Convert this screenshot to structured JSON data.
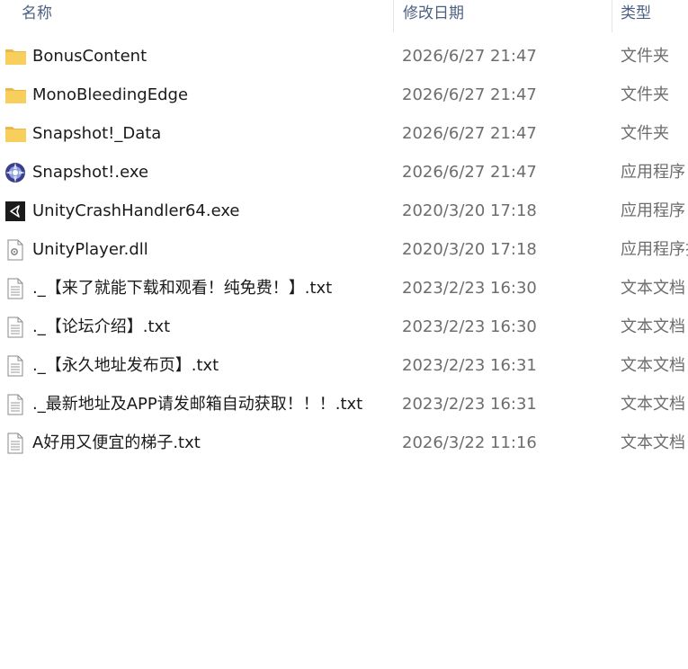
{
  "columns": {
    "name": "名称",
    "date": "修改日期",
    "type": "类型"
  },
  "files": [
    {
      "icon": "folder-icon",
      "name": "BonusContent",
      "date": "2026/6/27 21:47",
      "type": "文件夹"
    },
    {
      "icon": "folder-icon",
      "name": "MonoBleedingEdge",
      "date": "2026/6/27 21:47",
      "type": "文件夹"
    },
    {
      "icon": "folder-icon",
      "name": "Snapshot!_Data",
      "date": "2026/6/27 21:47",
      "type": "文件夹"
    },
    {
      "icon": "snapshot-app-icon",
      "name": "Snapshot!.exe",
      "date": "2026/6/27 21:47",
      "type": "应用程序"
    },
    {
      "icon": "unity-icon",
      "name": "UnityCrashHandler64.exe",
      "date": "2020/3/20 17:18",
      "type": "应用程序"
    },
    {
      "icon": "dll-file-icon",
      "name": "UnityPlayer.dll",
      "date": "2020/3/20 17:18",
      "type": "应用程序扩"
    },
    {
      "icon": "text-file-icon",
      "name": "._【来了就能下载和观看！纯免费！】.txt",
      "date": "2023/2/23 16:30",
      "type": "文本文档"
    },
    {
      "icon": "text-file-icon",
      "name": "._【论坛介绍】.txt",
      "date": "2023/2/23 16:30",
      "type": "文本文档"
    },
    {
      "icon": "text-file-icon",
      "name": "._【永久地址发布页】.txt",
      "date": "2023/2/23 16:31",
      "type": "文本文档"
    },
    {
      "icon": "text-file-icon",
      "name": "._最新地址及APP请发邮箱自动获取！！！.txt",
      "date": "2023/2/23 16:31",
      "type": "文本文档"
    },
    {
      "icon": "text-file-icon",
      "name": "A好用又便宜的梯子.txt",
      "date": "2026/3/22 11:16",
      "type": "文本文档"
    }
  ]
}
